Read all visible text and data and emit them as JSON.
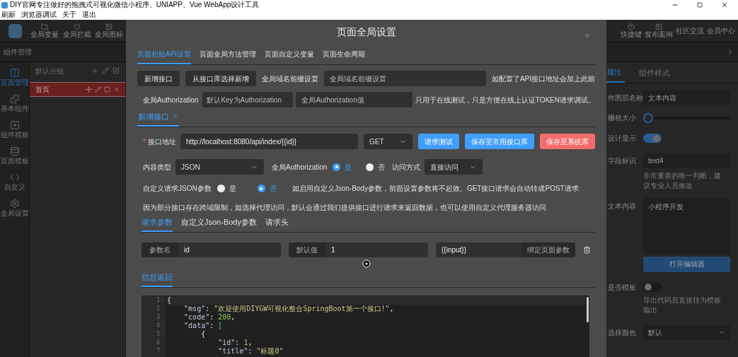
{
  "window": {
    "title": "DIY官网专注做好的拖拽式可视化微信小程序、UNIAPP、Vue WebApp设计工具"
  },
  "menu": [
    "刷新",
    "浏览器调试",
    "关于",
    "退出"
  ],
  "toolbar_left": [
    {
      "label": "全局变量",
      "kind": "folder"
    },
    {
      "label": "全局拦截",
      "kind": "shield"
    },
    {
      "label": "全局图标",
      "kind": "image"
    }
  ],
  "toolbar_right": [
    {
      "label": "快捷键",
      "kind": "help"
    },
    {
      "label": "发布案例",
      "kind": "image"
    },
    {
      "label": "社区交流",
      "kind": "none"
    },
    {
      "label": "会员中心",
      "kind": "none"
    }
  ],
  "panel_title": "组件管理",
  "nav": [
    {
      "label": "页面管理",
      "kind": "layout",
      "selected": true
    },
    {
      "label": "基本组件",
      "kind": "puzzle",
      "selected": false
    },
    {
      "label": "组件模板",
      "kind": "template",
      "selected": false
    },
    {
      "label": "页面模板",
      "kind": "database",
      "selected": false
    },
    {
      "label": "自定义",
      "kind": "code",
      "selected": false
    },
    {
      "label": "全局设置",
      "kind": "settings",
      "selected": false
    }
  ],
  "page_groups": {
    "group": "默认分组",
    "pages": [
      {
        "name": "首页",
        "selected": true
      }
    ]
  },
  "properties": {
    "tabs": [
      {
        "label": "属性",
        "selected": true
      },
      {
        "label": "组件样式",
        "selected": false
      }
    ],
    "rows": [
      {
        "kind": "input",
        "label": "件图层名称",
        "value": "文本内容"
      },
      {
        "kind": "slider",
        "label": "栅格大小",
        "level": 0
      },
      {
        "kind": "toggle",
        "label": "设计显示",
        "on": true
      },
      {
        "kind": "input",
        "label": "字段标识",
        "value": "text4",
        "hint": "非常重要的唯一判断，建议专业人员修改"
      },
      {
        "kind": "textarea",
        "label": "文本内容",
        "value": "小程序开发",
        "button": "打开编辑器"
      },
      {
        "kind": "toggle",
        "label": "是否模板",
        "on": false,
        "hint": "导出代码后直接转为模板输出"
      },
      {
        "kind": "select",
        "label": "选择颜色",
        "value": "默认"
      }
    ]
  },
  "dialog": {
    "title": "页面全局设置",
    "tabs": [
      {
        "label": "页面初始API设置",
        "selected": true
      },
      {
        "label": "页面全局方法管理",
        "selected": false
      },
      {
        "label": "页面自定义变量",
        "selected": false
      },
      {
        "label": "页面生命周期",
        "selected": false
      }
    ],
    "add_button": "新增接口",
    "library_button": "从接口库选择新增",
    "prefix_label": "全局域名前缀设置",
    "prefix_placeholder": "全局域名前缀设置",
    "prefix_hint": "如配置了API接口地址会加上此前",
    "auth_label": "全局Authorization",
    "auth_key_placeholder": "默认Key为Authorization",
    "auth_value_placeholder": "全局Authorization值",
    "auth_hint": "只用于在线测试，只是方便在线上认证TOKEN请求调试。",
    "api_tabs": [
      {
        "label": "新增接口",
        "selected": true
      }
    ],
    "url_marker": "*",
    "url_label": "接口地址",
    "url": "http://localhost:8080/api/index/{{id}}",
    "method": "GET",
    "actions": [
      {
        "label": "请求测试",
        "kind": "primary"
      },
      {
        "label": "保存至常用接口库",
        "kind": "primary"
      },
      {
        "label": "保存至系统库",
        "kind": "danger"
      }
    ],
    "content_type_label": "内容类型",
    "content_type": "JSON",
    "global_auth": {
      "label": "全局Authorization",
      "options": [
        {
          "label": "是",
          "selected": true
        },
        {
          "label": "否",
          "selected": false
        }
      ]
    },
    "access_label": "访问方式",
    "access": "直接访问",
    "custom_json": {
      "label": "自定义请求JSON参数",
      "options": [
        {
          "label": "是",
          "selected": false
        },
        {
          "label": "否",
          "selected": true
        }
      ],
      "hint": "如启用自定义Json-Body参数，前面设置参数将不起效。GET接口请求会自动转成POST请求"
    },
    "proxy_note": "因为部分接口存在跨域限制，如选择代理访问，默认会通过我们提供接口进行请求来返回数据，也可以使用自定义代理服务器访问",
    "param_tabs": [
      {
        "label": "请求参数",
        "selected": true
      },
      {
        "label": "自定义Json-Body参数",
        "selected": false
      },
      {
        "label": "请求头",
        "selected": false
      }
    ],
    "params": [
      {
        "name_label": "参数名",
        "name": "id",
        "default_label": "默认值",
        "default": "1",
        "binding": "{{input}}",
        "bind_button": "绑定页面参数"
      }
    ],
    "response_tab": "信息返回",
    "code": [
      {
        "no": "1",
        "fold": true,
        "segments": [
          {
            "kind": "punct",
            "text": "{"
          }
        ]
      },
      {
        "no": "2",
        "fold": false,
        "segments": [
          {
            "kind": "key",
            "text": "    \"msg\""
          },
          {
            "kind": "punct",
            "text": ": "
          },
          {
            "kind": "string",
            "text": "\"欢迎使用DIYGW可视化整合SpringBoot第一个接口!\""
          },
          {
            "kind": "punct",
            "text": ","
          }
        ]
      },
      {
        "no": "3",
        "fold": false,
        "segments": [
          {
            "kind": "key",
            "text": "    \"code\""
          },
          {
            "kind": "punct",
            "text": ": "
          },
          {
            "kind": "number",
            "text": "200"
          },
          {
            "kind": "punct",
            "text": ","
          }
        ]
      },
      {
        "no": "4",
        "fold": true,
        "segments": [
          {
            "kind": "key",
            "text": "    \"data\""
          },
          {
            "kind": "punct",
            "text": ": "
          },
          {
            "kind": "bracket",
            "text": "["
          }
        ]
      },
      {
        "no": "5",
        "fold": true,
        "segments": [
          {
            "kind": "punct",
            "text": "        {"
          }
        ]
      },
      {
        "no": "6",
        "fold": false,
        "segments": [
          {
            "kind": "key",
            "text": "            \"id\""
          },
          {
            "kind": "punct",
            "text": ": "
          },
          {
            "kind": "number",
            "text": "1"
          },
          {
            "kind": "punct",
            "text": ","
          }
        ]
      },
      {
        "no": "7",
        "fold": false,
        "segments": [
          {
            "kind": "key",
            "text": "            \"title\""
          },
          {
            "kind": "punct",
            "text": ": "
          },
          {
            "kind": "string",
            "text": "\"标题0\""
          }
        ]
      }
    ]
  }
}
